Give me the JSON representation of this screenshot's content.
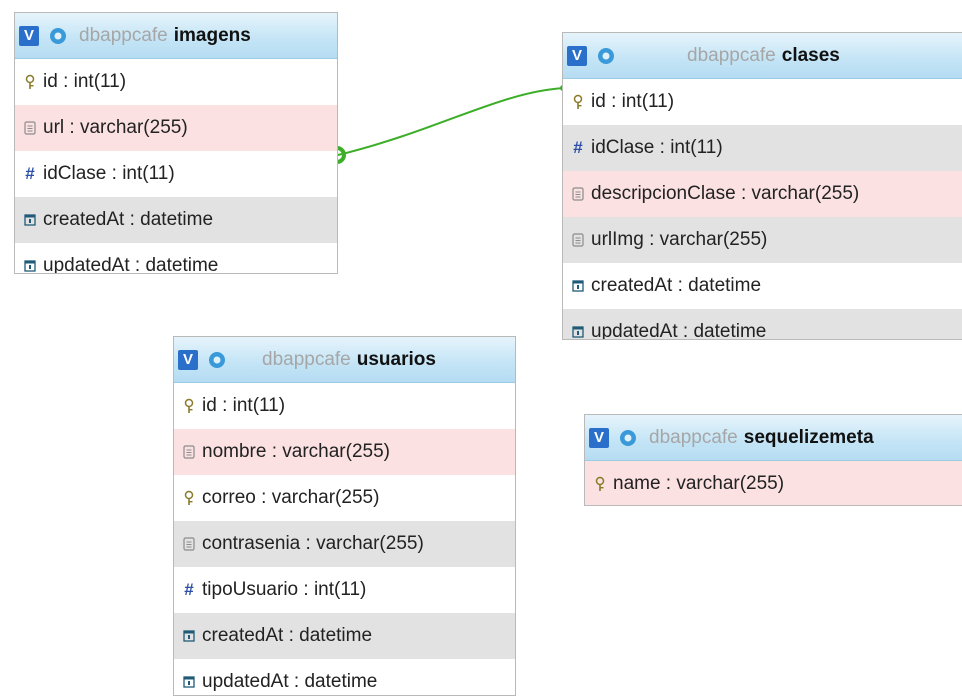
{
  "colors": {
    "relation_line": "#3cae28",
    "header_accent": "#2a6fc9"
  },
  "tables": {
    "imagens": {
      "db": "dbappcafe",
      "name": "imagens",
      "fields": [
        {
          "text": "id : int(11)",
          "icon": "key-icon"
        },
        {
          "text": "url : varchar(255)",
          "icon": "text-field-icon"
        },
        {
          "text": "idClase : int(11)",
          "icon": "hash-icon"
        },
        {
          "text": "createdAt : datetime",
          "icon": "datetime-icon"
        },
        {
          "text": "updatedAt : datetime",
          "icon": "datetime-icon"
        }
      ]
    },
    "clases": {
      "db": "dbappcafe",
      "name": "clases",
      "fields": [
        {
          "text": "id : int(11)",
          "icon": "key-icon"
        },
        {
          "text": "idClase : int(11)",
          "icon": "hash-icon"
        },
        {
          "text": "descripcionClase : varchar(255)",
          "icon": "text-field-icon"
        },
        {
          "text": "urlImg : varchar(255)",
          "icon": "text-field-icon"
        },
        {
          "text": "createdAt : datetime",
          "icon": "datetime-icon"
        },
        {
          "text": "updatedAt : datetime",
          "icon": "datetime-icon"
        }
      ]
    },
    "usuarios": {
      "db": "dbappcafe",
      "name": "usuarios",
      "fields": [
        {
          "text": "id : int(11)",
          "icon": "key-icon"
        },
        {
          "text": "nombre : varchar(255)",
          "icon": "text-field-icon"
        },
        {
          "text": "correo : varchar(255)",
          "icon": "key-icon"
        },
        {
          "text": "contrasenia : varchar(255)",
          "icon": "text-field-icon"
        },
        {
          "text": "tipoUsuario : int(11)",
          "icon": "hash-icon"
        },
        {
          "text": "createdAt : datetime",
          "icon": "datetime-icon"
        },
        {
          "text": "updatedAt : datetime",
          "icon": "datetime-icon"
        }
      ]
    },
    "sequelizemeta": {
      "db": "dbappcafe",
      "name": "sequelizemeta",
      "fields": [
        {
          "text": "name : varchar(255)",
          "icon": "key-icon"
        }
      ]
    }
  }
}
